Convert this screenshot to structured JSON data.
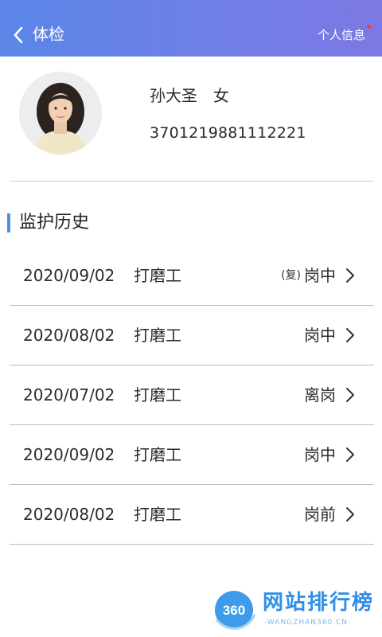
{
  "header": {
    "title": "体检",
    "profile_link": "个人信息",
    "back_icon": "chevron-left-icon",
    "background_gradient": [
      "#5a86e8",
      "#7d78e4"
    ]
  },
  "person": {
    "name": "孙大圣",
    "gender": "女",
    "id_number": "3701219881112221"
  },
  "section": {
    "title": "监护历史",
    "accent": "#4a90e2"
  },
  "records": [
    {
      "date": "2020/09/02",
      "job": "打磨工",
      "tag": "(复)",
      "status": "岗中"
    },
    {
      "date": "2020/08/02",
      "job": "打磨工",
      "tag": "",
      "status": "岗中"
    },
    {
      "date": "2020/07/02",
      "job": "打磨工",
      "tag": "",
      "status": "离岗"
    },
    {
      "date": "2020/09/02",
      "job": "打磨工",
      "tag": "",
      "status": "岗中"
    },
    {
      "date": "2020/08/02",
      "job": "打磨工",
      "tag": "",
      "status": "岗前"
    }
  ],
  "watermark": {
    "logo_text": "360",
    "title": "网站排行榜",
    "subtitle": "-WANGZHAN360.CN-"
  }
}
